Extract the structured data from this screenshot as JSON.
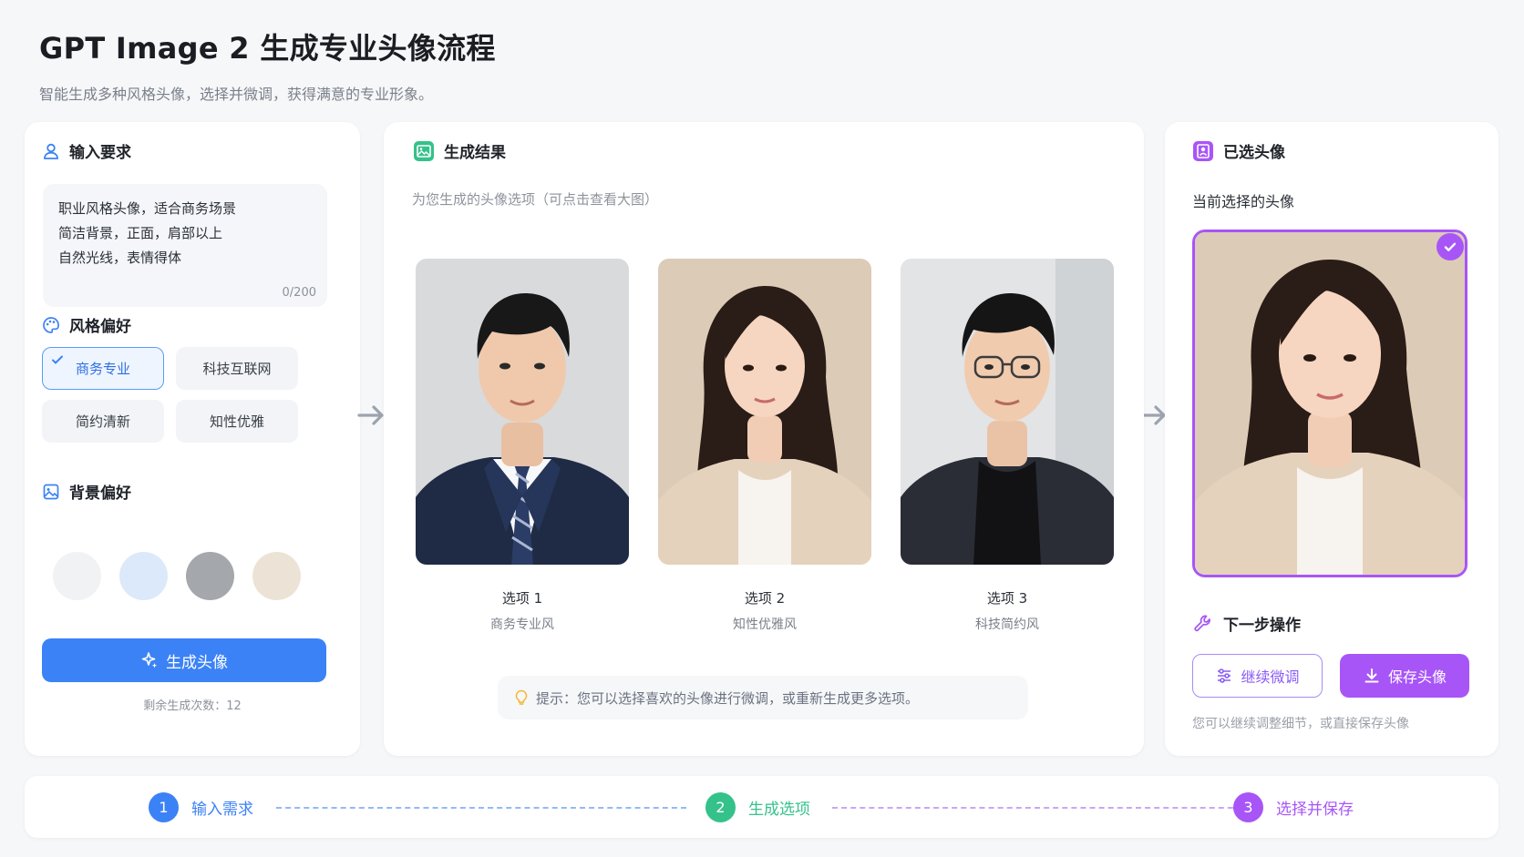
{
  "header": {
    "title": "GPT Image 2 生成专业头像流程",
    "subtitle": "智能生成多种风格头像，选择并微调，获得满意的专业形象。"
  },
  "input_panel": {
    "title": "输入要求",
    "prompt_lines": [
      "职业风格头像，适合商务场景",
      "简洁背景，正面，肩部以上",
      "自然光线，表情得体"
    ],
    "char_count": "0/200",
    "style_title": "风格偏好",
    "styles": [
      "商务专业",
      "科技互联网",
      "简约清新",
      "知性优雅"
    ],
    "selected_style": "商务专业",
    "background_title": "背景偏好",
    "background_colors": [
      "#f1f2f4",
      "#dbe9fb",
      "#a4a7ab",
      "#ece3d6"
    ],
    "generate_label": "生成头像",
    "remaining": "剩余生成次数：12"
  },
  "results_panel": {
    "title": "生成结果",
    "subtitle": "为您生成的头像选项（可点击查看大图）",
    "options": [
      {
        "label": "选项 1",
        "style": "商务专业风"
      },
      {
        "label": "选项 2",
        "style": "知性优雅风"
      },
      {
        "label": "选项 3",
        "style": "科技简约风"
      }
    ],
    "tip": "提示：您可以选择喜欢的头像进行微调，或重新生成更多选项。"
  },
  "selected_panel": {
    "title": "已选头像",
    "subtitle": "当前选择的头像",
    "next_title": "下一步操作",
    "fine_tune_label": "继续微调",
    "save_label": "保存头像",
    "hint": "您可以继续调整细节，或直接保存头像"
  },
  "stepper": {
    "steps": [
      {
        "num": "1",
        "label": "输入需求",
        "color": "#3b82f6"
      },
      {
        "num": "2",
        "label": "生成选项",
        "color": "#34c28a"
      },
      {
        "num": "3",
        "label": "选择并保存",
        "color": "#a855f7"
      }
    ]
  },
  "colors": {
    "blue": "#3b82f6",
    "green": "#34c28a",
    "purple": "#a855f7"
  }
}
